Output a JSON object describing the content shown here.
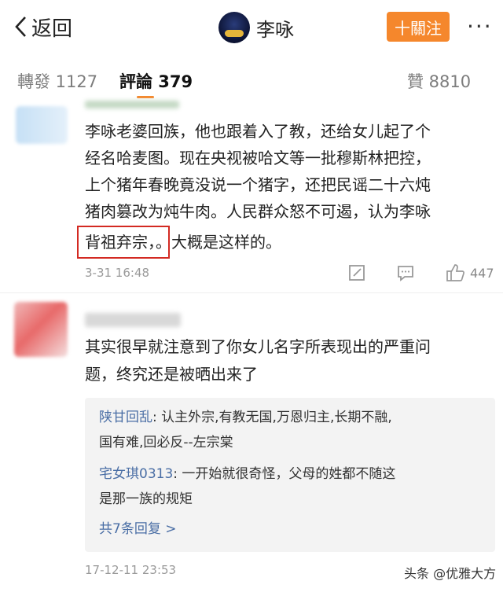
{
  "nav": {
    "back_label": "返回",
    "title": "李咏",
    "follow_label": "十關注",
    "more_label": "···"
  },
  "tabs": {
    "repost": "轉發 1127",
    "comment": "評論 379",
    "like": "贊 8810"
  },
  "comment1": {
    "lines": [
      "李咏老婆回族，他也跟着入了教，还给女儿起了个",
      "经名哈麦图。现在央视被哈文等一批穆斯林把控，",
      "上个猪年春晚竟没说一个猪字，还把民谣二十六炖",
      "猪肉篡改为炖牛肉。人民群众怒不可遏，认为李咏"
    ],
    "highlight": "背祖弃宗，",
    "tail": "。大概是这样的。",
    "time": "3-31 16:48",
    "like_count": "447"
  },
  "comment2": {
    "lines": [
      "其实很早就注意到了你女儿名字所表现出的严重问",
      "题，终究还是被晒出来了"
    ],
    "replies": [
      {
        "user": "陕甘回乱",
        "text": ": 认主外宗,有教无国,万恩归主,长期不融,",
        "text2": "国有难,回必反--左宗棠"
      },
      {
        "user": "宅女琪0313",
        "text": ": 一开始就很奇怪，父母的姓都不随这",
        "text2": "是那一族的规矩"
      }
    ],
    "more_replies": "共7条回复 >",
    "time": "17-12-11 23:53"
  },
  "watermark": "头条 @优雅大方",
  "colors": {
    "accent": "#f5872c",
    "link": "#4a6ea5",
    "highlight_border": "#d32a22"
  }
}
